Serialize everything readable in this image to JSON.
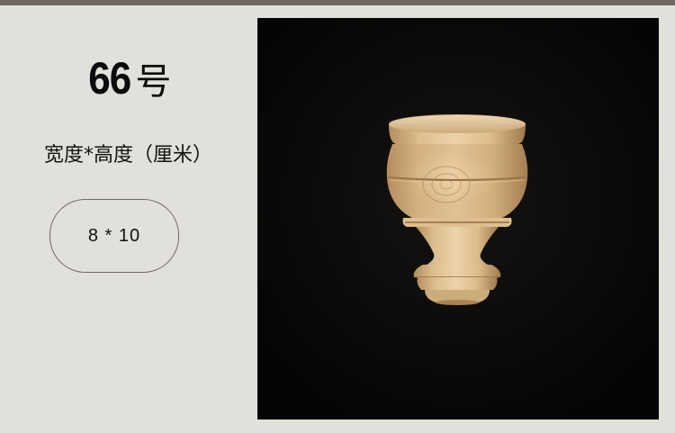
{
  "model": {
    "number": "66",
    "suffix": "号"
  },
  "dimensions": {
    "label": "宽度*高度（厘米）",
    "value": "8 * 10"
  },
  "photo": {
    "subject": "wooden-furniture-leg",
    "background_color": "#070707",
    "wood_color": "#e2c396"
  },
  "colors": {
    "page_background": "#e2e0db",
    "top_bar": "#6d6661",
    "text": "#111111"
  }
}
